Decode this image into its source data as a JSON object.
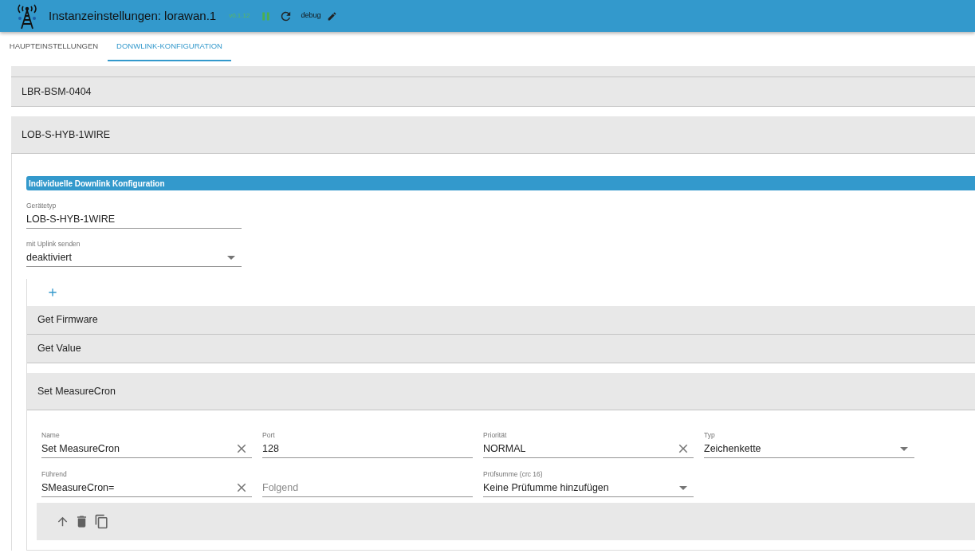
{
  "header": {
    "title": "Instanzeinstellungen: lorawan.1",
    "version": "v0.1.12",
    "running": true,
    "log_level": "debug"
  },
  "tabs": [
    {
      "label": "HAUPTEINSTELLUNGEN",
      "selected": false
    },
    {
      "label": "DONWLINK-KONFIGURATION",
      "selected": true
    }
  ],
  "devices": [
    {
      "label": "LBR-BSM-0404",
      "expanded": false
    },
    {
      "label": "LOB-S-HYB-1WIRE",
      "expanded": true,
      "config": {
        "title": "Individuelle Downlink Konfiguration",
        "fields": [
          {
            "kind": "text",
            "label": "Gerätetyp",
            "value": "LOB-S-HYB-1WIRE"
          },
          {
            "kind": "select",
            "label": "mit Uplink senden",
            "value": "deaktiviert"
          }
        ],
        "downlinks": [
          {
            "label": "Get Firmware",
            "expanded": false
          },
          {
            "label": "Get Value",
            "expanded": false
          },
          {
            "label": "Set MeasureCron",
            "expanded": true,
            "field_rows": [
              [
                {
                  "kind": "clearable",
                  "label": "Name",
                  "value": "Set MeasureCron"
                },
                {
                  "kind": "text",
                  "label": "Port",
                  "value": "128"
                },
                {
                  "kind": "clearable",
                  "label": "Priorität",
                  "value": "NORMAL"
                },
                {
                  "kind": "select",
                  "label": "Typ",
                  "value": "Zeichenkette"
                }
              ],
              [
                {
                  "kind": "clearable",
                  "label": "Führend",
                  "value": "SMeasureCron="
                },
                {
                  "kind": "text",
                  "placeholder": "Folgend"
                },
                {
                  "kind": "select",
                  "label": "Prüfsumme (crc 16)",
                  "value": "Keine Prüfumme hinzufügen"
                }
              ]
            ]
          }
        ]
      }
    }
  ]
}
